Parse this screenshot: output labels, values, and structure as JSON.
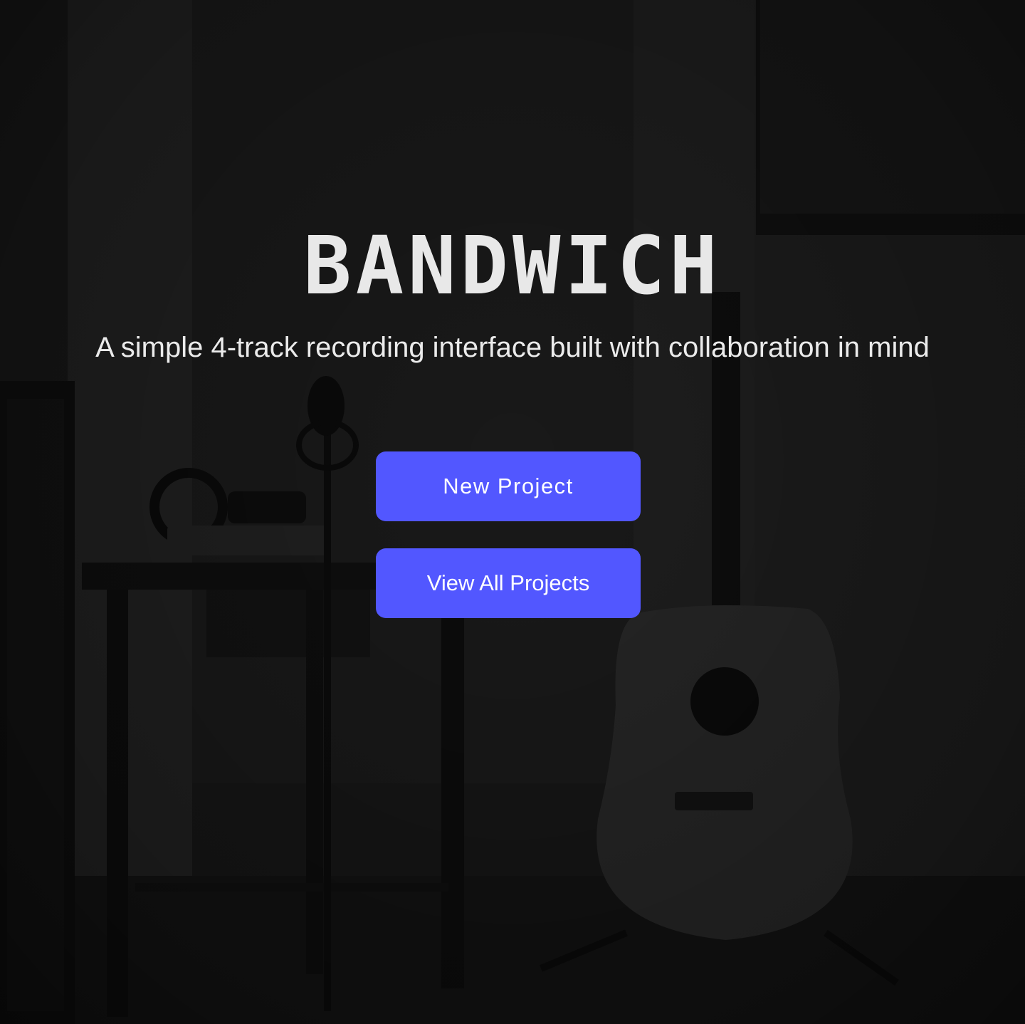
{
  "hero": {
    "title": "BANDWICH",
    "tagline": "A simple 4-track recording interface built with collaboration in mind"
  },
  "actions": {
    "new_project_label": "New Project",
    "view_all_label": "View All Projects"
  },
  "colors": {
    "accent": "#5257ff",
    "title_text": "#e8e8e8",
    "background": "#161616"
  },
  "background_image": {
    "description_icon": "studio-photo"
  }
}
